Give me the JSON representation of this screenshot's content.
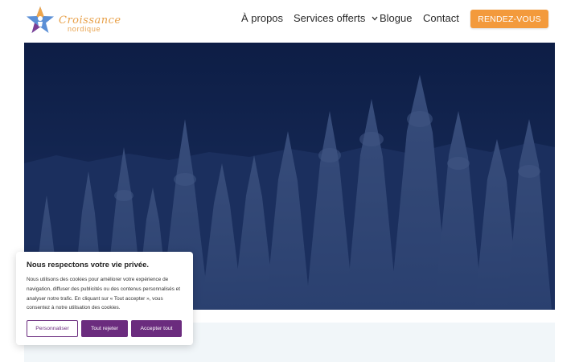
{
  "header": {
    "logo": {
      "line1": "Croissance",
      "line2": "nordique"
    },
    "nav": {
      "apropos": "À propos",
      "services": "Services offerts",
      "blog": "Blogue",
      "contact": "Contact"
    },
    "cta_label": "RENDEZ-VOUS"
  },
  "cookie": {
    "title": "Nous respectons votre vie privée.",
    "text": "Nous utilisons des cookies pour améliorer votre expérience de navigation, diffuser des publicités ou des contenus personnalisés et analyser notre trafic. En cliquant sur « Tout accepter », vous consentez à notre utilisation des cookies.",
    "customize_label": "Personnaliser",
    "reject_label": "Tout rejeter",
    "accept_label": "Accepter tout"
  },
  "colors": {
    "cta": "#f39a3c",
    "accent_purple": "#6b2c7e",
    "hero_overlay": "#0e2047",
    "below_section": "#f1f6f9"
  }
}
